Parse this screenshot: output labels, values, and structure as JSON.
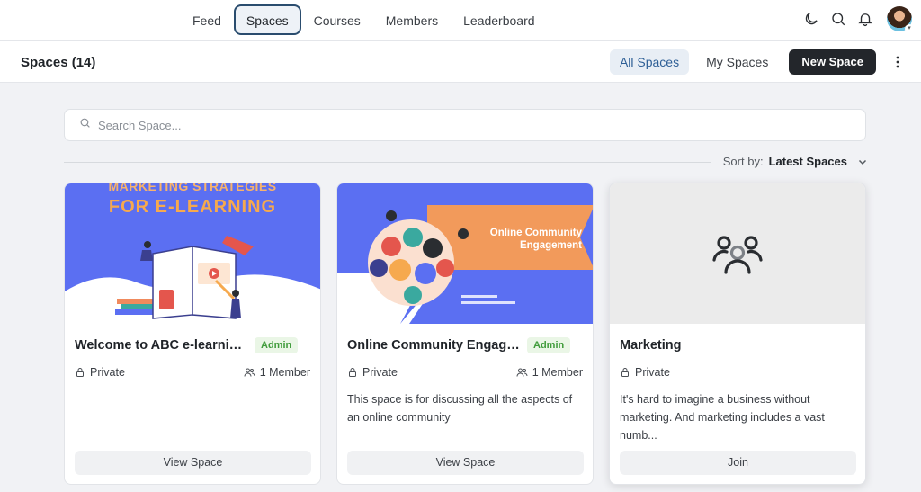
{
  "nav": {
    "links": [
      "Feed",
      "Spaces",
      "Courses",
      "Members",
      "Leaderboard"
    ],
    "active": "Spaces"
  },
  "subheader": {
    "title": "Spaces (14)",
    "all_spaces": "All Spaces",
    "my_spaces": "My Spaces",
    "new_space": "New Space"
  },
  "search": {
    "placeholder": "Search Space..."
  },
  "sort": {
    "label": "Sort by:",
    "value": "Latest Spaces"
  },
  "cards": [
    {
      "cover_line1": "MARKETING STRATEGIES",
      "cover_line2": "FOR E-LEARNING",
      "title": "Welcome to ABC e-learnin...",
      "badge": "Admin",
      "privacy": "Private",
      "members": "1 Member",
      "description": "",
      "button": "View Space"
    },
    {
      "cover_title": "Online Community Engagement",
      "title": "Online Community Engagem...",
      "badge": "Admin",
      "privacy": "Private",
      "members": "1 Member",
      "description": "This space is for discussing all the aspects of an online community",
      "button": "View Space"
    },
    {
      "title": "Marketing",
      "privacy": "Private",
      "description": "It's hard to imagine a business without marketing. And marketing includes a vast numb...",
      "button": "Join"
    }
  ],
  "colors": {
    "accent": "#2e5f96",
    "dark_button": "#23262b",
    "badge_green": "#3f9b3a",
    "cover_blue": "#5b6ff2",
    "cover_orange": "#f29a5b"
  },
  "icons": [
    "moon-icon",
    "search-icon",
    "bell-icon",
    "lock-icon",
    "members-icon",
    "kebab-icon",
    "chevron-down-icon",
    "group-icon"
  ]
}
